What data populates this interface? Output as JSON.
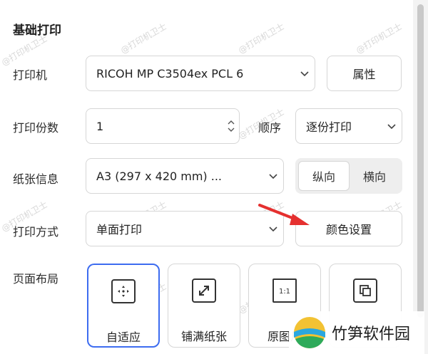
{
  "section": {
    "title": "基础打印"
  },
  "printer": {
    "label": "打印机",
    "selected": "RICOH MP C3504ex PCL 6",
    "properties_button": "属性"
  },
  "copies": {
    "label": "打印份数",
    "value": "1",
    "order_label": "顺序",
    "order_selected": "逐份打印"
  },
  "paper": {
    "label": "纸张信息",
    "selected": "A3 (297 x 420 mm) ...",
    "orientation": [
      {
        "label": "纵向",
        "active": true
      },
      {
        "label": "横向",
        "active": false
      }
    ]
  },
  "mode": {
    "label": "打印方式",
    "selected": "单面打印",
    "color_settings_button": "颜色设置"
  },
  "layout": {
    "label": "页面布局",
    "options": [
      {
        "label": "自适应",
        "icon": "fit-icon",
        "selected": true
      },
      {
        "label": "铺满纸张",
        "icon": "expand-icon",
        "selected": false
      },
      {
        "label": "原图尺",
        "icon": "actual-size-icon",
        "selected": false
      },
      {
        "label": "",
        "icon": "tile-icon",
        "selected": false
      }
    ]
  },
  "watermark_text": "@打印机卫士",
  "brand": {
    "name": "竹笋软件园"
  },
  "colors": {
    "accent": "#3d6cf0",
    "arrow": "#e5302f",
    "border": "#d6d6d6"
  }
}
